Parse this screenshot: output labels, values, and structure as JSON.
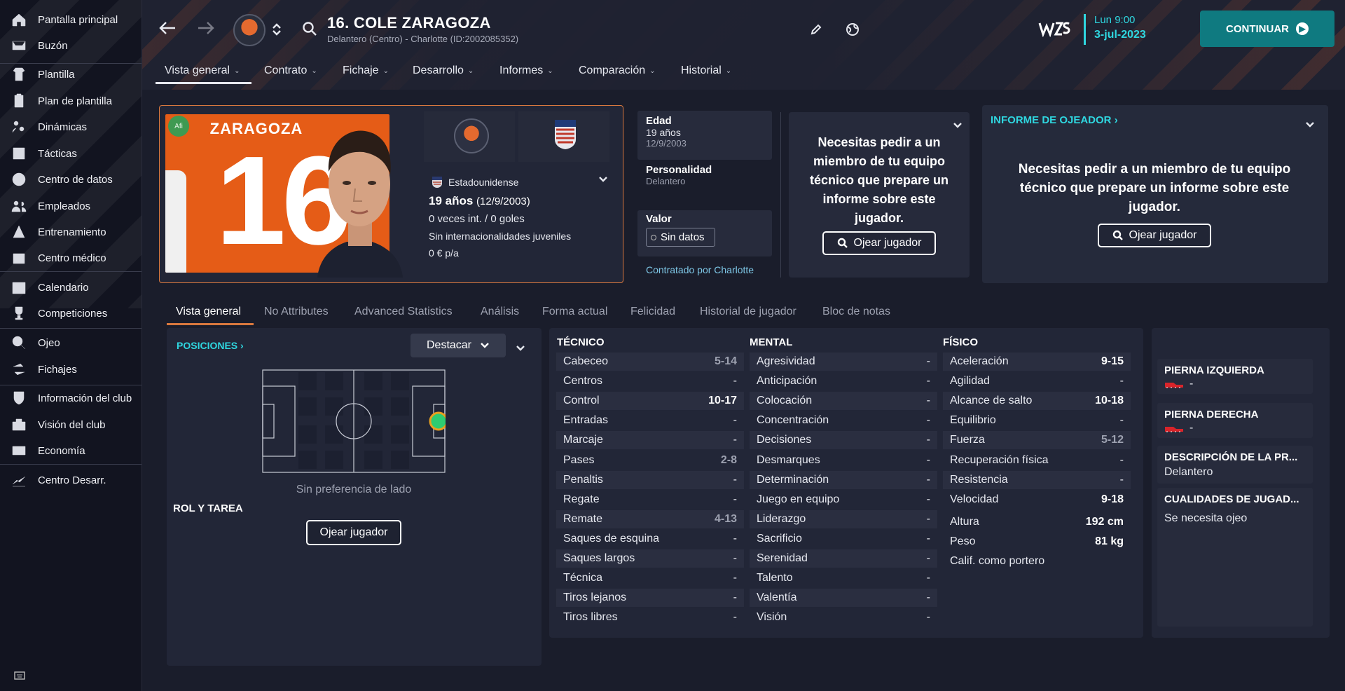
{
  "sidebar": {
    "items": [
      {
        "label": "Pantalla principal",
        "icon": "home-icon"
      },
      {
        "label": "Buzón",
        "icon": "inbox-icon"
      },
      {
        "label": "Plantilla",
        "icon": "squad-icon"
      },
      {
        "label": "Plan de plantilla",
        "icon": "clipboard-icon"
      },
      {
        "label": "Dinámicas",
        "icon": "dynamics-icon"
      },
      {
        "label": "Tácticas",
        "icon": "tactics-icon"
      },
      {
        "label": "Centro de datos",
        "icon": "data-hub-icon"
      },
      {
        "label": "Empleados",
        "icon": "staff-icon"
      },
      {
        "label": "Entrenamiento",
        "icon": "training-icon"
      },
      {
        "label": "Centro médico",
        "icon": "medical-icon"
      },
      {
        "label": "Calendario",
        "icon": "calendar-icon"
      },
      {
        "label": "Competiciones",
        "icon": "trophy-icon"
      },
      {
        "label": "Ojeo",
        "icon": "scouting-icon"
      },
      {
        "label": "Fichajes",
        "icon": "transfers-icon"
      },
      {
        "label": "Información del club",
        "icon": "club-info-icon"
      },
      {
        "label": "Visión del club",
        "icon": "club-vision-icon"
      },
      {
        "label": "Economía",
        "icon": "finances-icon"
      },
      {
        "label": "Centro Desarr.",
        "icon": "dev-centre-icon"
      }
    ]
  },
  "header": {
    "player_title": "16. COLE ZARAGOZA",
    "player_subtitle": "Delantero (Centro) - Charlotte (ID:2002085352)",
    "date_time": "Lun 9:00",
    "date_date": "3-jul-2023",
    "continue_label": "CONTINUAR",
    "tabs": [
      "Vista general",
      "Contrato",
      "Fichaje",
      "Desarrollo",
      "Informes",
      "Comparación",
      "Historial"
    ]
  },
  "card": {
    "shirt_name": "ZARAGOZA",
    "shirt_number": "16",
    "badge": "Afi",
    "nationality": "Estadounidense",
    "age_bold": "19 años",
    "dob": "(12/9/2003)",
    "caps": "0 veces int. / 0 goles",
    "youth_caps": "Sin internacionalidades juveniles",
    "wage": "0 € p/a"
  },
  "info": {
    "age_label": "Edad",
    "age_value": "19 años",
    "age_dob": "12/9/2003",
    "personality_label": "Personalidad",
    "personality_value": "Delantero",
    "value_label": "Valor",
    "value_button": "Sin datos",
    "contracted": "Contratado por Charlotte"
  },
  "scout_mid": {
    "message": "Necesitas pedir a un miembro de tu equipo técnico que prepare un informe sobre este jugador.",
    "button": "Ojear jugador"
  },
  "scout_report": {
    "title": "INFORME DE OJEADOR",
    "message": "Necesitas pedir a un miembro de tu equipo técnico que prepare un informe sobre este jugador.",
    "button": "Ojear jugador"
  },
  "subtabs": [
    "Vista general",
    "No Attributes",
    "Advanced Statistics",
    "Análisis",
    "Forma actual",
    "Felicidad",
    "Historial de jugador",
    "Bloc de notas"
  ],
  "positions": {
    "title": "POSICIONES",
    "highlight": "Destacar",
    "side_pref": "Sin preferencia de lado",
    "role_title": "ROL Y TAREA",
    "scout_button": "Ojear jugador"
  },
  "attributes": {
    "technical_title": "TÉCNICO",
    "mental_title": "MENTAL",
    "physical_title": "FÍSICO",
    "technical": [
      {
        "name": "Cabeceo",
        "value": "5-14",
        "style": "mid"
      },
      {
        "name": "Centros",
        "value": "-",
        "style": ""
      },
      {
        "name": "Control",
        "value": "10-17",
        "style": "strong"
      },
      {
        "name": "Entradas",
        "value": "-",
        "style": ""
      },
      {
        "name": "Marcaje",
        "value": "-",
        "style": ""
      },
      {
        "name": "Pases",
        "value": "2-8",
        "style": "mid"
      },
      {
        "name": "Penaltis",
        "value": "-",
        "style": ""
      },
      {
        "name": "Regate",
        "value": "-",
        "style": ""
      },
      {
        "name": "Remate",
        "value": "4-13",
        "style": "mid"
      },
      {
        "name": "Saques de esquina",
        "value": "-",
        "style": ""
      },
      {
        "name": "Saques largos",
        "value": "-",
        "style": ""
      },
      {
        "name": "Técnica",
        "value": "-",
        "style": ""
      },
      {
        "name": "Tiros lejanos",
        "value": "-",
        "style": ""
      },
      {
        "name": "Tiros libres",
        "value": "-",
        "style": ""
      }
    ],
    "mental": [
      {
        "name": "Agresividad",
        "value": "-",
        "style": ""
      },
      {
        "name": "Anticipación",
        "value": "-",
        "style": ""
      },
      {
        "name": "Colocación",
        "value": "-",
        "style": ""
      },
      {
        "name": "Concentración",
        "value": "-",
        "style": ""
      },
      {
        "name": "Decisiones",
        "value": "-",
        "style": ""
      },
      {
        "name": "Desmarques",
        "value": "-",
        "style": ""
      },
      {
        "name": "Determinación",
        "value": "-",
        "style": ""
      },
      {
        "name": "Juego en equipo",
        "value": "-",
        "style": ""
      },
      {
        "name": "Liderazgo",
        "value": "-",
        "style": ""
      },
      {
        "name": "Sacrificio",
        "value": "-",
        "style": ""
      },
      {
        "name": "Serenidad",
        "value": "-",
        "style": ""
      },
      {
        "name": "Talento",
        "value": "-",
        "style": ""
      },
      {
        "name": "Valentía",
        "value": "-",
        "style": ""
      },
      {
        "name": "Visión",
        "value": "-",
        "style": ""
      }
    ],
    "physical": [
      {
        "name": "Aceleración",
        "value": "9-15",
        "style": "strong"
      },
      {
        "name": "Agilidad",
        "value": "-",
        "style": ""
      },
      {
        "name": "Alcance de salto",
        "value": "10-18",
        "style": "strong"
      },
      {
        "name": "Equilibrio",
        "value": "-",
        "style": ""
      },
      {
        "name": "Fuerza",
        "value": "5-12",
        "style": "mid"
      },
      {
        "name": "Recuperación física",
        "value": "-",
        "style": ""
      },
      {
        "name": "Resistencia",
        "value": "-",
        "style": ""
      },
      {
        "name": "Velocidad",
        "value": "9-18",
        "style": "strong"
      }
    ],
    "physical_extra": [
      {
        "name": "Altura",
        "value": "192 cm"
      },
      {
        "name": "Peso",
        "value": "81 kg"
      },
      {
        "name": "Calif. como portero",
        "value": ""
      }
    ]
  },
  "side": {
    "left_foot_title": "PIERNA IZQUIERDA",
    "left_foot_value": "-",
    "right_foot_title": "PIERNA DERECHA",
    "right_foot_value": "-",
    "position_desc_title": "DESCRIPCIÓN DE LA PR...",
    "position_desc_value": "Delantero",
    "qualities_title": "CUALIDADES DE JUGAD...",
    "qualities_value": "Se necesita ojeo"
  },
  "colors": {
    "accent_cyan": "#2fd7e0",
    "accent_orange": "#d9783e",
    "continue_teal": "#0f7a80",
    "position_green": "#2ecc71"
  }
}
